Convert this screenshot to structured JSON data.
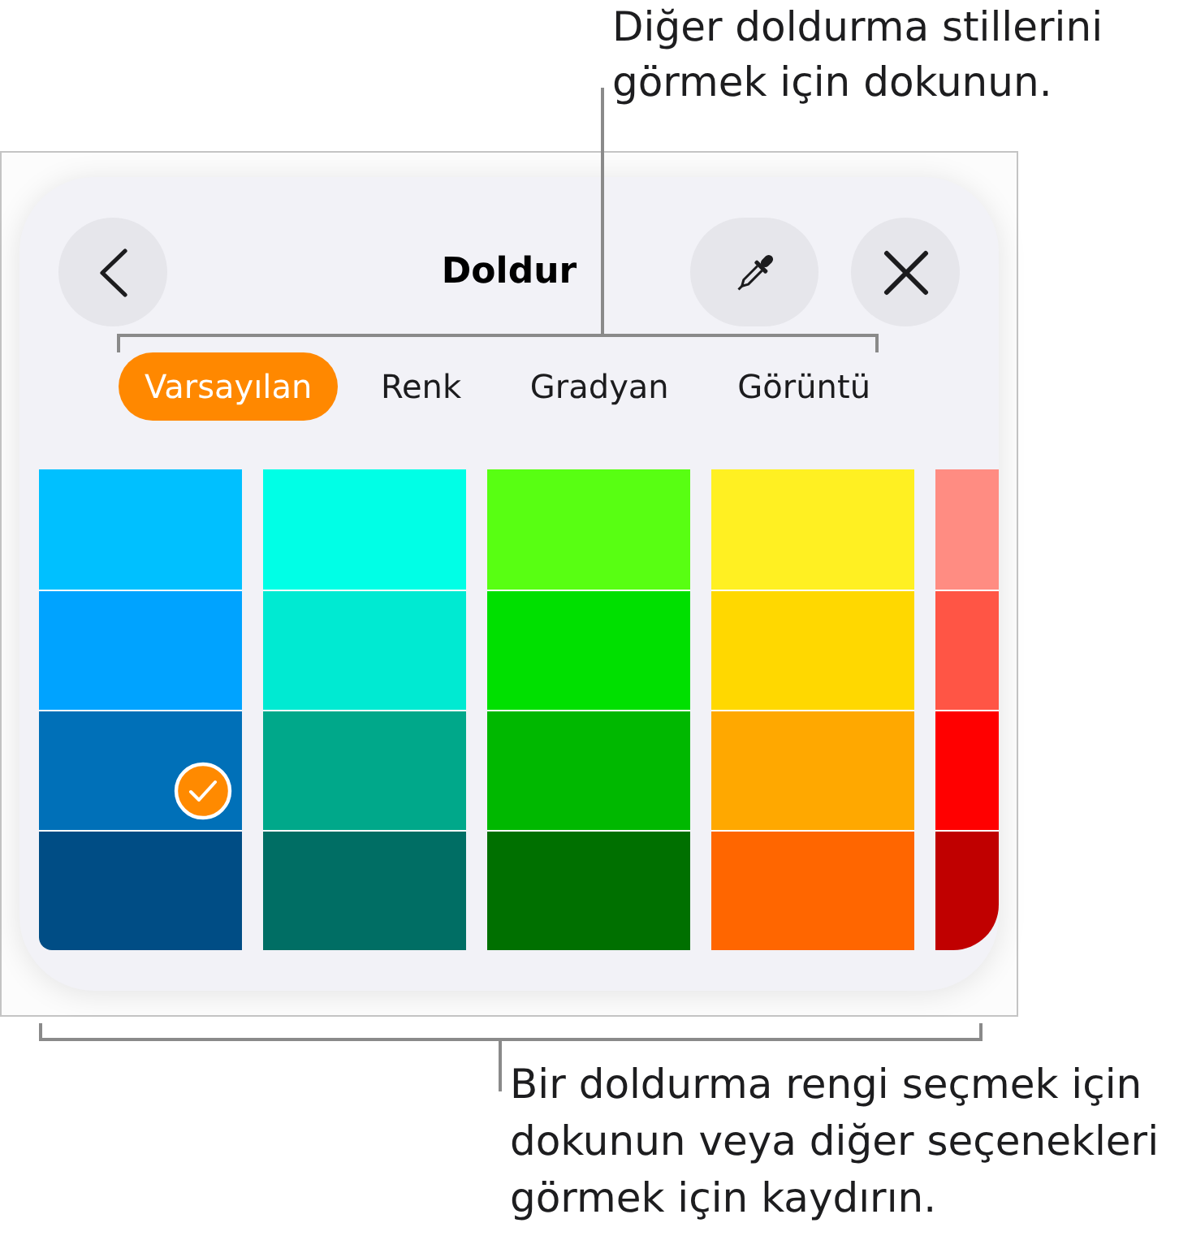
{
  "callout_top": {
    "text": "Diğer doldurma stillerini görmek için dokunun."
  },
  "panel": {
    "title": "Doldur",
    "tabs": [
      {
        "label": "Varsayılan",
        "selected": true
      },
      {
        "label": "Renk",
        "selected": false
      },
      {
        "label": "Gradyan",
        "selected": false
      },
      {
        "label": "Görüntü",
        "selected": false
      }
    ],
    "swatch_columns": [
      {
        "swatches": [
          {
            "color": "#00c0ff",
            "selected": false
          },
          {
            "color": "#00a3ff",
            "selected": false
          },
          {
            "color": "#0070b8",
            "selected": true
          },
          {
            "color": "#004d85",
            "selected": false
          }
        ]
      },
      {
        "swatches": [
          {
            "color": "#00ffe6",
            "selected": false
          },
          {
            "color": "#00ead2",
            "selected": false
          },
          {
            "color": "#00a88a",
            "selected": false
          },
          {
            "color": "#006e64",
            "selected": false
          }
        ]
      },
      {
        "swatches": [
          {
            "color": "#58ff12",
            "selected": false
          },
          {
            "color": "#00e000",
            "selected": false
          },
          {
            "color": "#00b800",
            "selected": false
          },
          {
            "color": "#007000",
            "selected": false
          }
        ]
      },
      {
        "swatches": [
          {
            "color": "#fff022",
            "selected": false
          },
          {
            "color": "#ffd800",
            "selected": false
          },
          {
            "color": "#ffa800",
            "selected": false
          },
          {
            "color": "#ff6600",
            "selected": false
          }
        ]
      },
      {
        "swatches": [
          {
            "color": "#ff8c82",
            "selected": false
          },
          {
            "color": "#ff5545",
            "selected": false
          },
          {
            "color": "#ff0000",
            "selected": false
          },
          {
            "color": "#c00000",
            "selected": false
          }
        ]
      }
    ]
  },
  "callout_bottom": {
    "text": "Bir doldurma rengi seçmek için dokunun veya diğer seçenekleri görmek için kaydırın."
  }
}
